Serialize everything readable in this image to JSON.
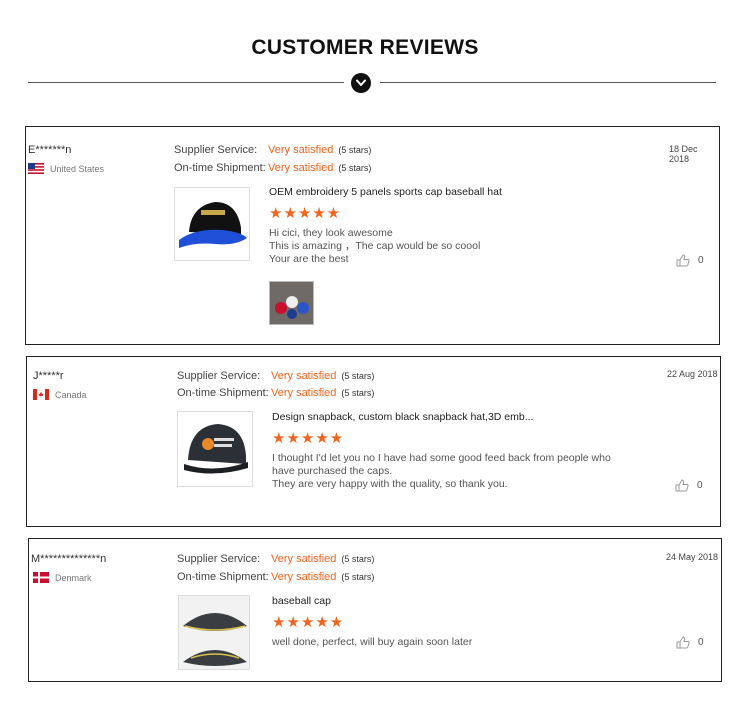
{
  "heading": "CUSTOMER REVIEWS",
  "divider_icon": "chevron-down-icon",
  "colors": {
    "accent": "#f0641e",
    "border": "#222222"
  },
  "reviews": [
    {
      "reviewer": "E*******n",
      "country": "United States",
      "flag": "us-flag",
      "supplier_label": "Supplier Service:",
      "supplier_value": "Very satisfied",
      "supplier_stars": "(5 stars)",
      "shipment_label": "On-time Shipment:",
      "shipment_value": "Very satisfied",
      "shipment_stars": "(5 stars)",
      "date": "18 Dec 2018",
      "product_title": "OEM embroidery 5 panels sports cap baseball hat",
      "stars": "★★★★★",
      "comment": [
        "Hi cici, they look awesome",
        "This is amazing ，The cap would be so coool",
        "Your are the best"
      ],
      "likes": "0"
    },
    {
      "reviewer": "J*****r",
      "country": "Canada",
      "flag": "canada-flag",
      "supplier_label": "Supplier Service:",
      "supplier_value": "Very satisfied",
      "supplier_stars": "(5 stars)",
      "shipment_label": "On-time Shipment:",
      "shipment_value": "Very satisfied",
      "shipment_stars": "(5 stars)",
      "date": "22 Aug 2018",
      "product_title": "Design snapback, custom black snapback hat,3D emb...",
      "stars": "★★★★★",
      "comment": [
        "I thought I'd let you no I have had some good feed back from people who have purchased the caps.",
        "They are very happy with the quality, so thank you."
      ],
      "likes": "0"
    },
    {
      "reviewer": "M**************n",
      "country": "Denmark",
      "flag": "denmark-flag",
      "supplier_label": "Supplier Service:",
      "supplier_value": "Very satisfied",
      "supplier_stars": "(5 stars)",
      "shipment_label": "On-time Shipment:",
      "shipment_value": "Very satisfied",
      "shipment_stars": "(5 stars)",
      "date": "24 May 2018",
      "product_title": "baseball cap",
      "stars": "★★★★★",
      "comment": [
        "well done, perfect, will buy again soon later"
      ],
      "likes": "0"
    }
  ]
}
